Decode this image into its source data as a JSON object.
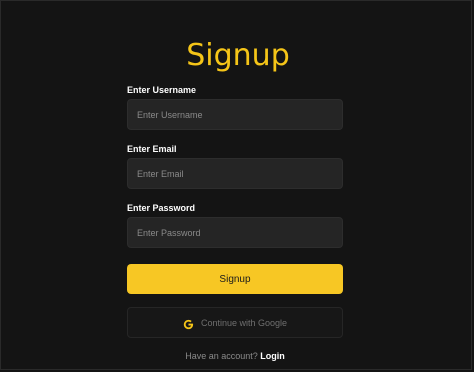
{
  "title": "Signup",
  "fields": {
    "username": {
      "label": "Enter Username",
      "placeholder": "Enter Username",
      "value": ""
    },
    "email": {
      "label": "Enter Email",
      "placeholder": "Enter Email",
      "value": ""
    },
    "password": {
      "label": "Enter Password",
      "placeholder": "Enter Password",
      "value": ""
    }
  },
  "signup_button": "Signup",
  "google_button": {
    "label": "Continue with Google",
    "icon": "google-g-icon"
  },
  "login_prompt": {
    "text": "Have an account?",
    "link": "Login"
  },
  "colors": {
    "accent": "#f7c724",
    "background": "#141414",
    "input": "#252525"
  }
}
